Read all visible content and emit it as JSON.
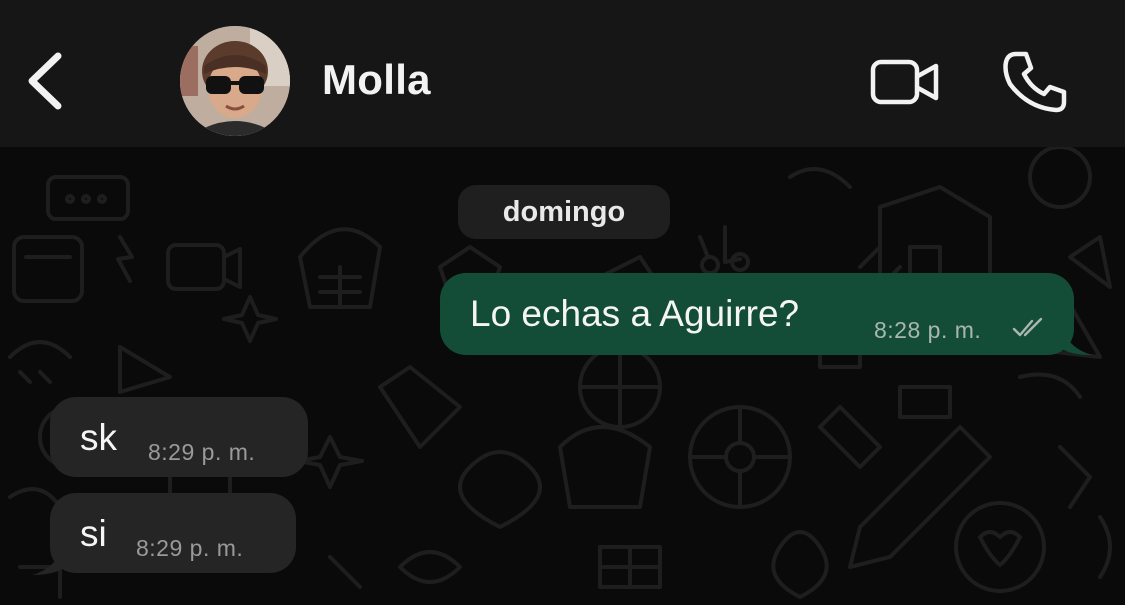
{
  "header": {
    "contact_name": "Molla",
    "icons": {
      "back": "chevron-left-icon",
      "video": "video-camera-icon",
      "call": "phone-icon"
    }
  },
  "chat": {
    "date_separator": "domingo",
    "messages": [
      {
        "direction": "outgoing",
        "text": "Lo echas a Aguirre?",
        "time": "8:28 p. m.",
        "status": "read"
      },
      {
        "direction": "incoming",
        "text": "sk",
        "time": "8:29 p. m."
      },
      {
        "direction": "incoming",
        "text": "si",
        "time": "8:29 p. m."
      }
    ]
  },
  "colors": {
    "outgoing_bubble": "#134d37",
    "incoming_bubble": "#252525",
    "header_bg": "#161616",
    "read_ticks": "#a9b7b0"
  }
}
